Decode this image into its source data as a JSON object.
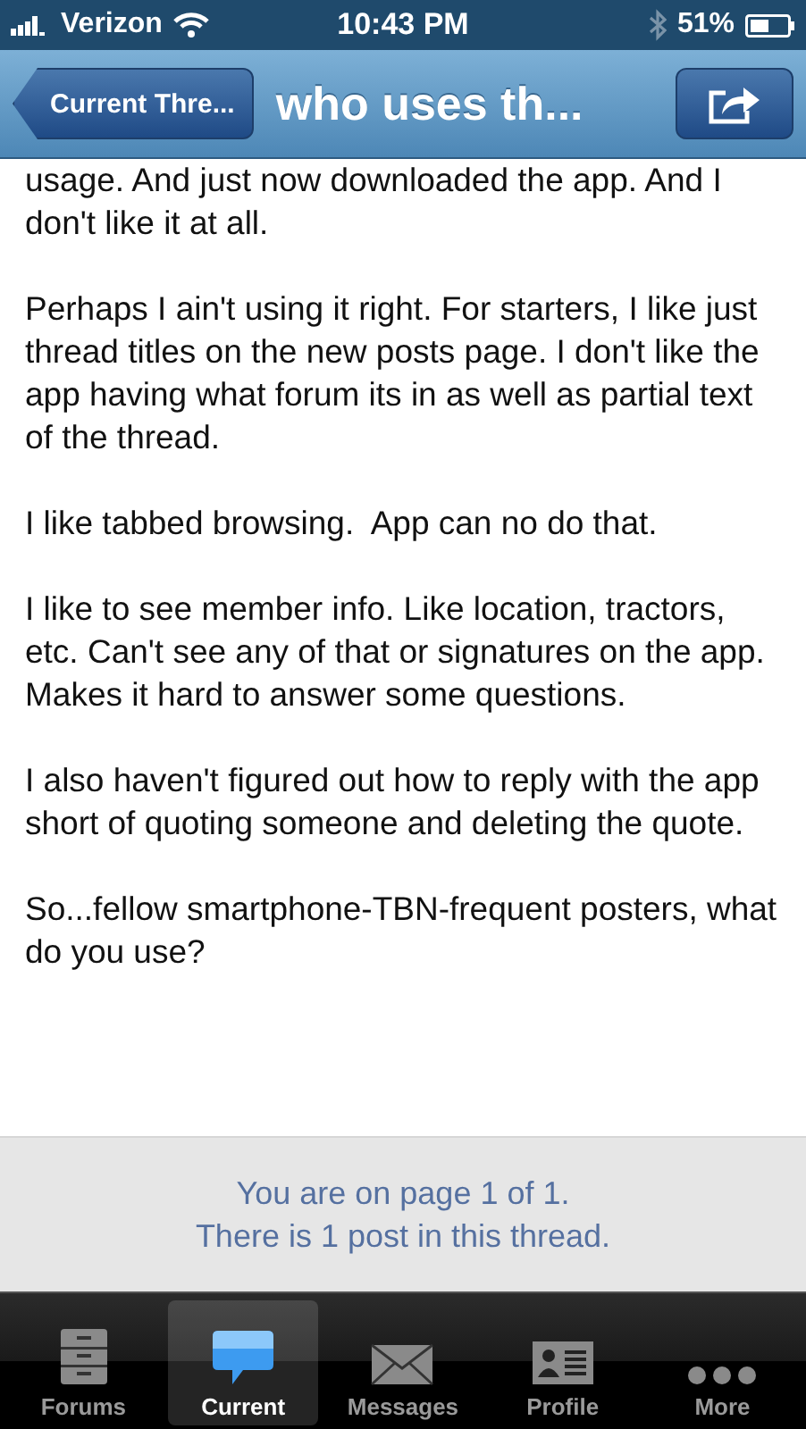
{
  "status_bar": {
    "carrier": "Verizon",
    "time": "10:43 PM",
    "battery": "51%"
  },
  "nav_bar": {
    "back_button": "Current Thre...",
    "title": "who uses th..."
  },
  "post": {
    "paragraphs": [
      "usage. And just now downloaded the app. And I don't like it at all.",
      "Perhaps I ain't using it right. For starters, I like just thread titles on the new posts page. I don't like the app having what forum its in as well as partial text of the thread.",
      "I like tabbed browsing.  App can no do that.",
      "I like to see member info. Like location, tractors, etc. Can't see any of that or signatures on the app. Makes it hard to answer some questions.",
      "I also haven't figured out how to reply with the app short of quoting someone and deleting the quote.",
      "So...fellow smartphone-TBN-frequent posters, what do you use?"
    ]
  },
  "footer": {
    "lines": [
      "You are on page 1 of 1.",
      "There is 1 post in this thread."
    ]
  },
  "tab_bar": [
    {
      "label": "Forums",
      "kind": "drawer",
      "selected": false
    },
    {
      "label": "Current",
      "kind": "bubble",
      "selected": true
    },
    {
      "label": "Messages",
      "kind": "envelope",
      "selected": false
    },
    {
      "label": "Profile",
      "kind": "card",
      "selected": false
    },
    {
      "label": "More",
      "kind": "dots",
      "selected": false
    }
  ]
}
